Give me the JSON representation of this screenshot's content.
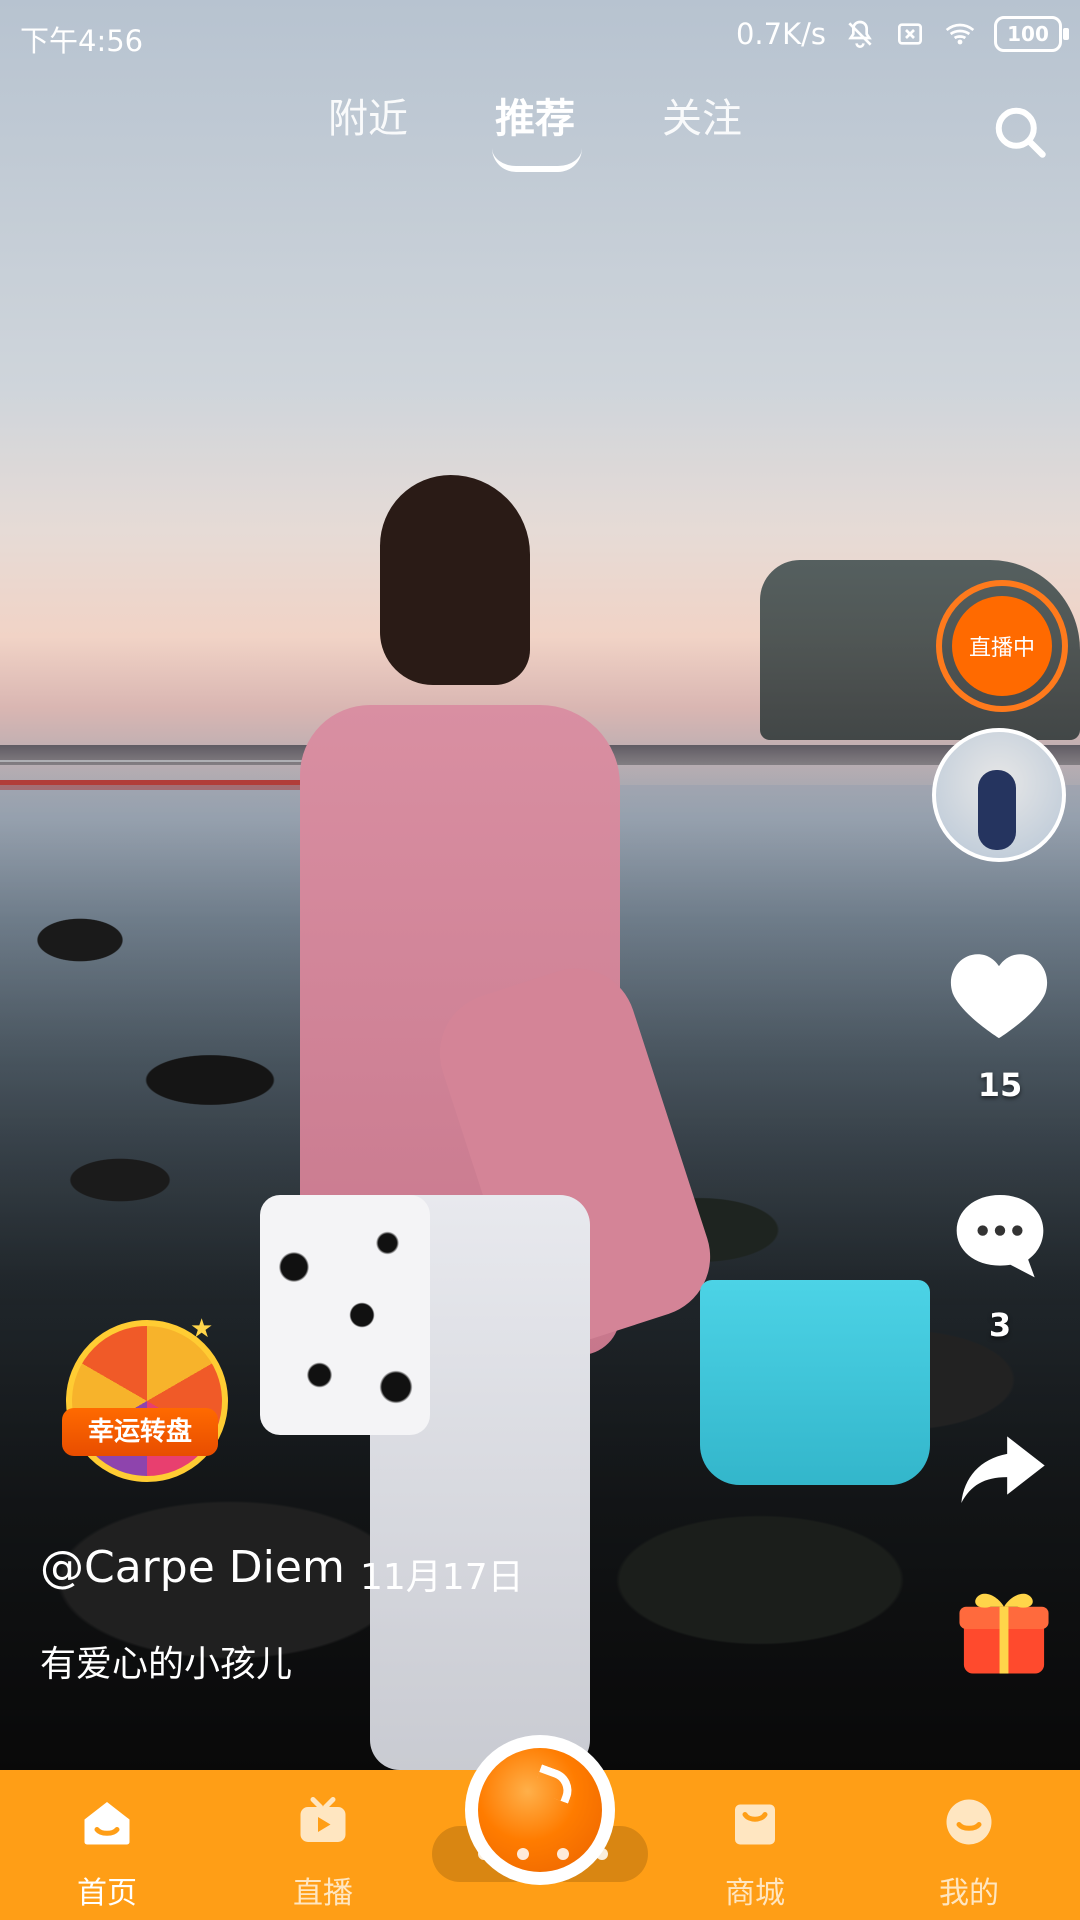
{
  "status_bar": {
    "time": "下午4:56",
    "network_speed": "0.7K/s",
    "battery": "100"
  },
  "top_tabs": [
    {
      "label": "附近",
      "active": false
    },
    {
      "label": "推荐",
      "active": true
    },
    {
      "label": "关注",
      "active": false
    }
  ],
  "right_rail": {
    "live_badge": "直播中",
    "likes": "15",
    "comments": "3"
  },
  "promo": {
    "lucky_wheel_label": "幸运转盘"
  },
  "post": {
    "username": "@Carpe Diem",
    "date": "11月17日",
    "caption": "有爱心的小孩儿"
  },
  "bottom_nav": [
    {
      "label": "首页",
      "icon": "home-icon",
      "active": true
    },
    {
      "label": "直播",
      "icon": "tv-play-icon",
      "active": false
    },
    {
      "label": "商城",
      "icon": "shop-bag-icon",
      "active": false
    },
    {
      "label": "我的",
      "icon": "smile-profile-icon",
      "active": false
    }
  ],
  "colors": {
    "accent_orange": "#ff9e16",
    "live_orange": "#ff6a00"
  }
}
